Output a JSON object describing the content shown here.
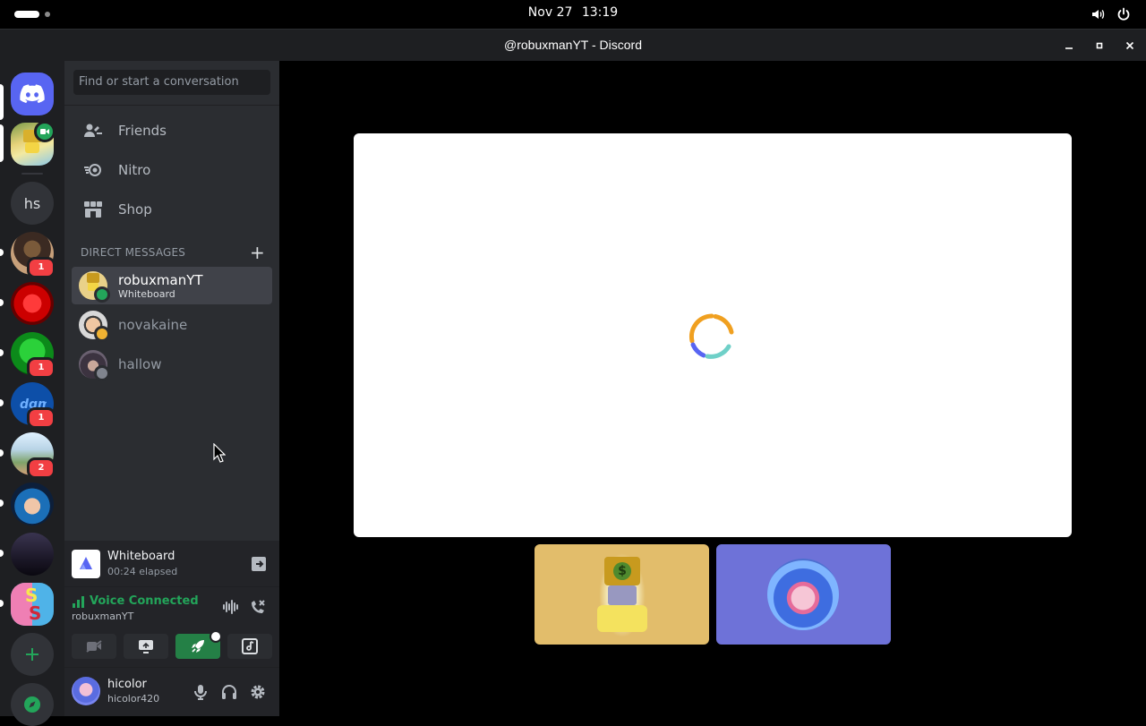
{
  "system_bar": {
    "date": "Nov 27",
    "time": "13:19",
    "icons": [
      "activities-indicator",
      "volume-icon",
      "power-icon"
    ]
  },
  "window": {
    "title": "@robuxmanYT - Discord",
    "buttons": [
      "minimize",
      "maximize",
      "close"
    ]
  },
  "rail": {
    "home_icon": "discord-logo-icon",
    "servers": [
      {
        "name": "server-voice-active",
        "badge": ""
      },
      {
        "name": "hs",
        "label": "hs",
        "badge": ""
      },
      {
        "name": "server-circus",
        "badge": "1"
      },
      {
        "name": "server-red-flower",
        "badge": ""
      },
      {
        "name": "server-green-frog",
        "badge": "1"
      },
      {
        "name": "server-dgm",
        "badge": "1"
      },
      {
        "name": "server-anime-mountains",
        "badge": "2"
      },
      {
        "name": "server-anime-girl",
        "badge": ""
      },
      {
        "name": "server-dark-castle",
        "badge": ""
      },
      {
        "name": "server-ss",
        "badge": ""
      }
    ],
    "add_server_icon": "plus-icon",
    "discover_icon": "compass-icon"
  },
  "sidebar": {
    "search_placeholder": "Find or start a conversation",
    "nav": [
      {
        "label": "Friends",
        "icon": "friends-icon"
      },
      {
        "label": "Nitro",
        "icon": "nitro-icon"
      },
      {
        "label": "Shop",
        "icon": "shop-icon"
      }
    ],
    "dm_header": "DIRECT MESSAGES",
    "dms": [
      {
        "name": "robuxmanYT",
        "subtitle": "Whiteboard",
        "status": "online"
      },
      {
        "name": "novakaine",
        "subtitle": "",
        "status": "idle"
      },
      {
        "name": "hallow",
        "subtitle": "",
        "status": "offline"
      }
    ]
  },
  "activity": {
    "name": "Whiteboard",
    "elapsed": "00:24 elapsed"
  },
  "voice": {
    "status": "Voice Connected",
    "channel": "robuxmanYT"
  },
  "user": {
    "name": "hicolor",
    "tag": "hicolor420"
  },
  "colors": {
    "accent": "#5865f2",
    "online": "#23a55a",
    "idle": "#f0b232",
    "badge": "#f23f43",
    "tile_1": "#e2bd6b",
    "tile_2": "#6e72d8"
  }
}
